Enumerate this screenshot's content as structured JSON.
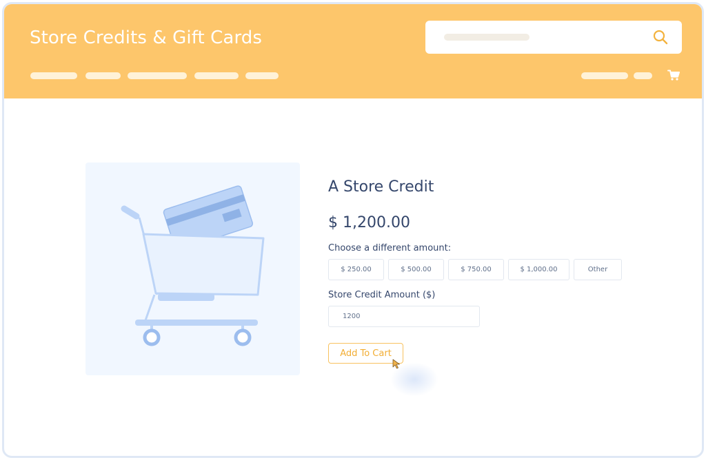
{
  "header": {
    "title": "Store Credits & Gift Cards",
    "icons": {
      "search": "search-icon",
      "cart": "cart-icon"
    }
  },
  "product": {
    "image_icon": "shopping-cart-with-card-icon",
    "title": "A Store Credit",
    "price": "$ 1,200.00",
    "choose_label": "Choose a different amount:",
    "amount_options": [
      "$ 250.00",
      "$ 500.00",
      "$ 750.00",
      "$ 1,000.00",
      "Other"
    ],
    "credit_amount_label": "Store Credit Amount ($)",
    "credit_amount_value": "1200",
    "add_to_cart_label": "Add To Cart"
  },
  "colors": {
    "header_bg": "#fdc66b",
    "accent": "#f2ad33",
    "text": "#34466b",
    "image_bg": "#f1f7ff"
  }
}
